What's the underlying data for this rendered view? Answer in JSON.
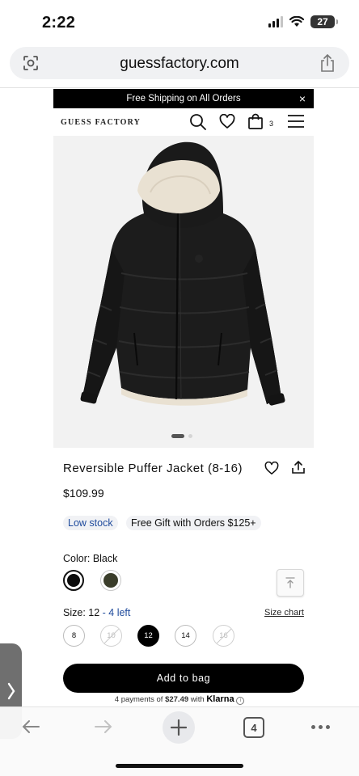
{
  "status_bar": {
    "time": "2:22",
    "battery": "27"
  },
  "browser": {
    "url": "guessfactory.com",
    "open_tabs": "4"
  },
  "promo": {
    "text": "Free Shipping on All Orders",
    "close": "×"
  },
  "header": {
    "logo": "GUESS FACTORY",
    "bag_count": "3"
  },
  "product": {
    "title": "Reversible Puffer Jacket (8-16)",
    "price": "$109.99",
    "badges": {
      "stock": "Low stock",
      "gift": "Free Gift with Orders $125+"
    },
    "color": {
      "label": "Color: Black",
      "swatches": [
        "#0c0c0c",
        "#3a3d2a"
      ]
    },
    "size": {
      "label": "Size: 12",
      "remaining": " - 4 left",
      "chart_link": "Size chart",
      "options": [
        "8",
        "10",
        "12",
        "14",
        "16"
      ]
    },
    "add_to_bag": "Add to bag",
    "klarna": {
      "prefix": "4 payments of ",
      "amount": "$27.49",
      "middle": " with ",
      "brand": "Klarna",
      "info": "i"
    }
  },
  "colors": {
    "accent_blue": "#1e4a9c",
    "button_black": "#000000"
  }
}
